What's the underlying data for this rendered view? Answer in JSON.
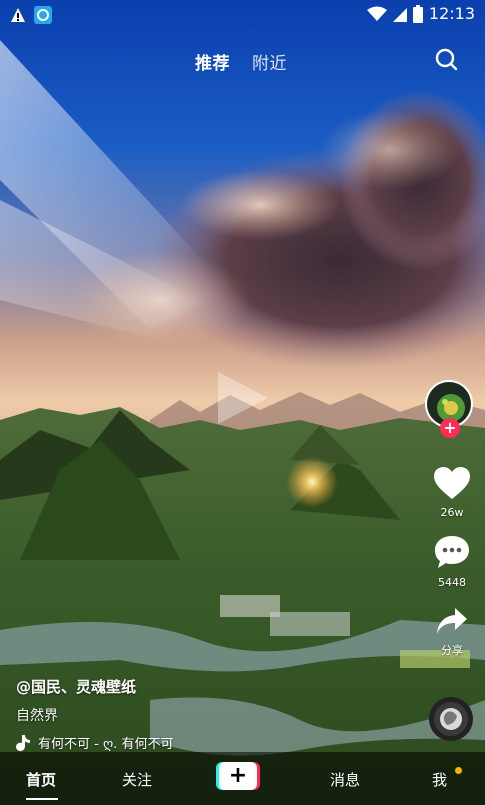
{
  "status": {
    "time": "12:13"
  },
  "top_tabs": {
    "recommend": "推荐",
    "nearby": "附近"
  },
  "rail": {
    "likes": "26w",
    "comments": "5448",
    "share": "分享"
  },
  "video": {
    "author": "@国民、灵魂壁纸",
    "category": "自然界",
    "music": "有何不可 - ღ.  有何不可"
  },
  "bottom_nav": {
    "home": "首页",
    "follow": "关注",
    "add": "+",
    "messages": "消息",
    "me": "我"
  },
  "colors": {
    "accent_pink": "#ff2c55",
    "notify_dot": "#f5b800",
    "plus_cyan": "#25f4ee",
    "plus_red": "#fe2c55"
  },
  "icons": [
    "android-icon",
    "app-icon",
    "wifi-icon",
    "signal-icon",
    "battery-icon",
    "search-icon",
    "play-icon",
    "heart-icon",
    "comment-icon",
    "share-icon",
    "music-note-icon",
    "music-disc-icon"
  ]
}
